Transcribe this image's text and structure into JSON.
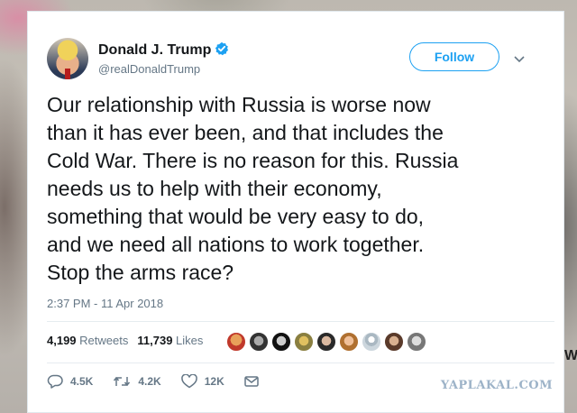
{
  "tweet": {
    "author_name": "Donald J. Trump",
    "handle": "@realDonaldTrump",
    "follow_label": "Follow",
    "text": "Our relationship with Russia is worse now\nthan it has ever been, and that includes the\nCold War. There is no reason for this. Russia\nneeds us to help with their economy,\nsomething that would be very easy to do,\nand we need all nations to work together.\nStop the arms race?",
    "timestamp": "2:37 PM - 11 Apr 2018",
    "retweets_count": "4,199",
    "retweets_label": "Retweets",
    "likes_count": "11,739",
    "likes_label": "Likes",
    "actions": {
      "reply_count": "4.5K",
      "retweet_count": "4.2K",
      "like_count": "12K"
    }
  },
  "watermark": "YAPLAKAL.COM",
  "edge_text": "W",
  "colors": {
    "accent": "#1da1f2",
    "text": "#14171a",
    "muted": "#657786",
    "divider": "#e6ecf0"
  },
  "icons": [
    "verified-badge-icon",
    "chevron-down-icon",
    "reply-icon",
    "retweet-icon",
    "like-icon",
    "message-icon"
  ]
}
